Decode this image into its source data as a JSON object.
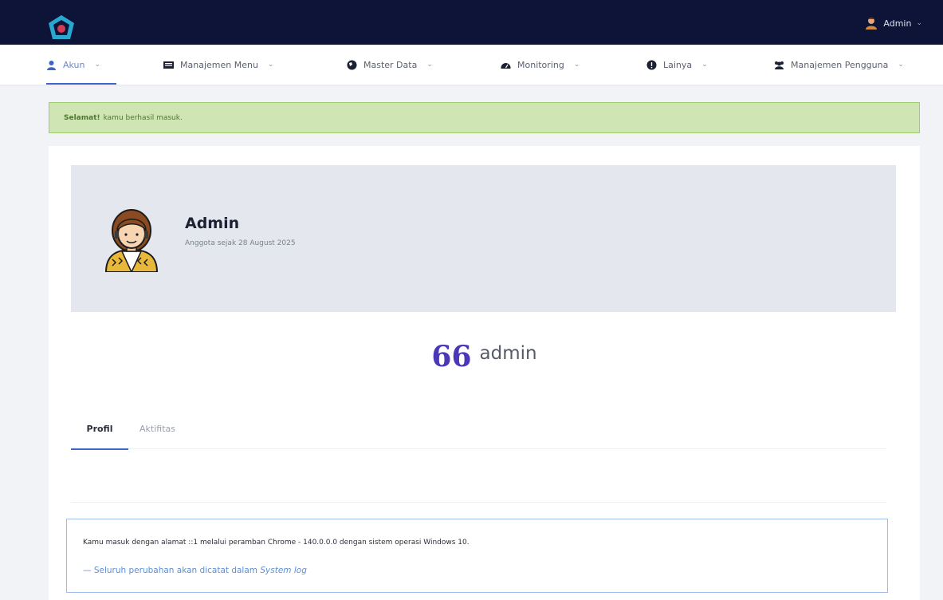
{
  "header": {
    "user_name": "Admin"
  },
  "nav": {
    "items": [
      {
        "label": "Akun"
      },
      {
        "label": "Manajemen Menu"
      },
      {
        "label": "Master Data"
      },
      {
        "label": "Monitoring"
      },
      {
        "label": "Lainya"
      },
      {
        "label": "Manajemen Pengguna"
      }
    ]
  },
  "alert": {
    "strong": "Selamat!",
    "text": "kamu berhasil masuk."
  },
  "profile": {
    "name": "Admin",
    "since": "Anggota sejak 28 August 2025",
    "quote_mark": "66",
    "quote": "admin"
  },
  "tabs": [
    {
      "label": "Profil"
    },
    {
      "label": "Aktifitas"
    }
  ],
  "info": {
    "text": "Kamu masuk dengan alamat ::1 melalui peramban Chrome - 140.0.0.0 dengan sistem operasi Windows 10.",
    "note_prefix": "— Seluruh perubahan akan dicatat dalam",
    "note_emph": "System log"
  },
  "colors": {
    "topbar": "#0d1437",
    "accent": "#3d66c7",
    "alert_bg": "#cfe6b4",
    "quote": "#4b38b8"
  }
}
